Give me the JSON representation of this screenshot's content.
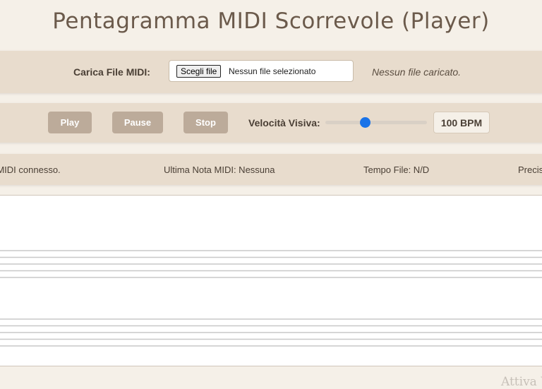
{
  "app": {
    "title": "Pentagramma MIDI Scorrevole (Player)"
  },
  "file_panel": {
    "label": "Carica File MIDI:",
    "choose_button": "Scegli file",
    "no_file_selected": "Nessun file selezionato",
    "status": "Nessun file caricato."
  },
  "controls": {
    "play": "Play",
    "pause": "Pause",
    "stop": "Stop",
    "speed_label": "Velocità Visiva:",
    "speed_value": 100,
    "bpm_display": "100 BPM",
    "accent_color": "#1a73e8"
  },
  "status_bar": {
    "device": "vo MIDI connesso.",
    "last_note": "Ultima Nota MIDI: Nessuna",
    "tempo": "Tempo File: N/D",
    "precision": "Precis"
  },
  "staff": {
    "treble_lines": 5,
    "bass_lines": 5
  },
  "watermark": "Attiva W"
}
